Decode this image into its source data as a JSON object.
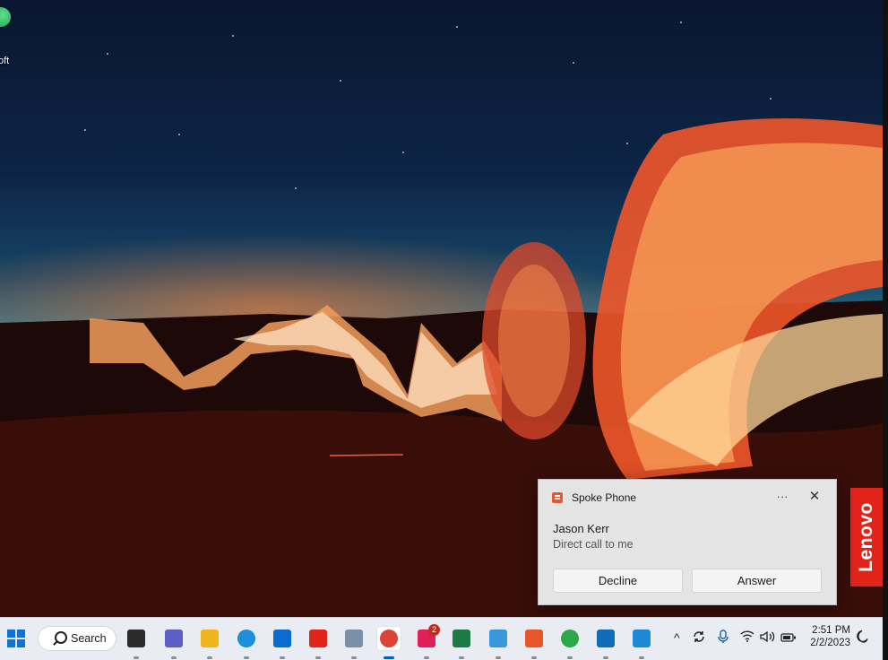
{
  "desktop": {
    "icon_label": "oft",
    "brand_badge": "Lenovo"
  },
  "notification": {
    "app_name": "Spoke Phone",
    "more_glyph": "···",
    "close_glyph": "✕",
    "caller": "Jason Kerr",
    "subtitle": "Direct call to me",
    "decline_label": "Decline",
    "answer_label": "Answer"
  },
  "taskbar": {
    "search_label": "Search",
    "apps": [
      {
        "icon": "task-view-icon",
        "color": "#2b2b2b"
      },
      {
        "icon": "teams-chat-icon",
        "color": "#5b5fc7"
      },
      {
        "icon": "file-explorer-icon",
        "color": "#f2b41b"
      },
      {
        "icon": "edge-icon",
        "color": "#1b8fd9"
      },
      {
        "icon": "microsoft-store-icon",
        "color": "#0a6cd1"
      },
      {
        "icon": "lenovo-vantage-icon",
        "color": "#e2231a"
      },
      {
        "icon": "calculator-icon",
        "color": "#7a8fa8"
      },
      {
        "icon": "chrome-icon",
        "color": "#db4437"
      },
      {
        "icon": "slack-icon",
        "color": "#e01e5a",
        "badge": "2"
      },
      {
        "icon": "excel-icon",
        "color": "#1d7a45"
      },
      {
        "icon": "notepad-icon",
        "color": "#3a96dd"
      },
      {
        "icon": "spoke-phone-icon",
        "color": "#e8572a"
      },
      {
        "icon": "maps-icon",
        "color": "#2ba84a"
      },
      {
        "icon": "outlook-icon",
        "color": "#0f6cbd"
      },
      {
        "icon": "photos-icon",
        "color": "#1e88d8"
      }
    ],
    "tray": {
      "chevron": "^",
      "clock_time": "2:51 PM",
      "clock_date": "2/2/2023"
    }
  }
}
